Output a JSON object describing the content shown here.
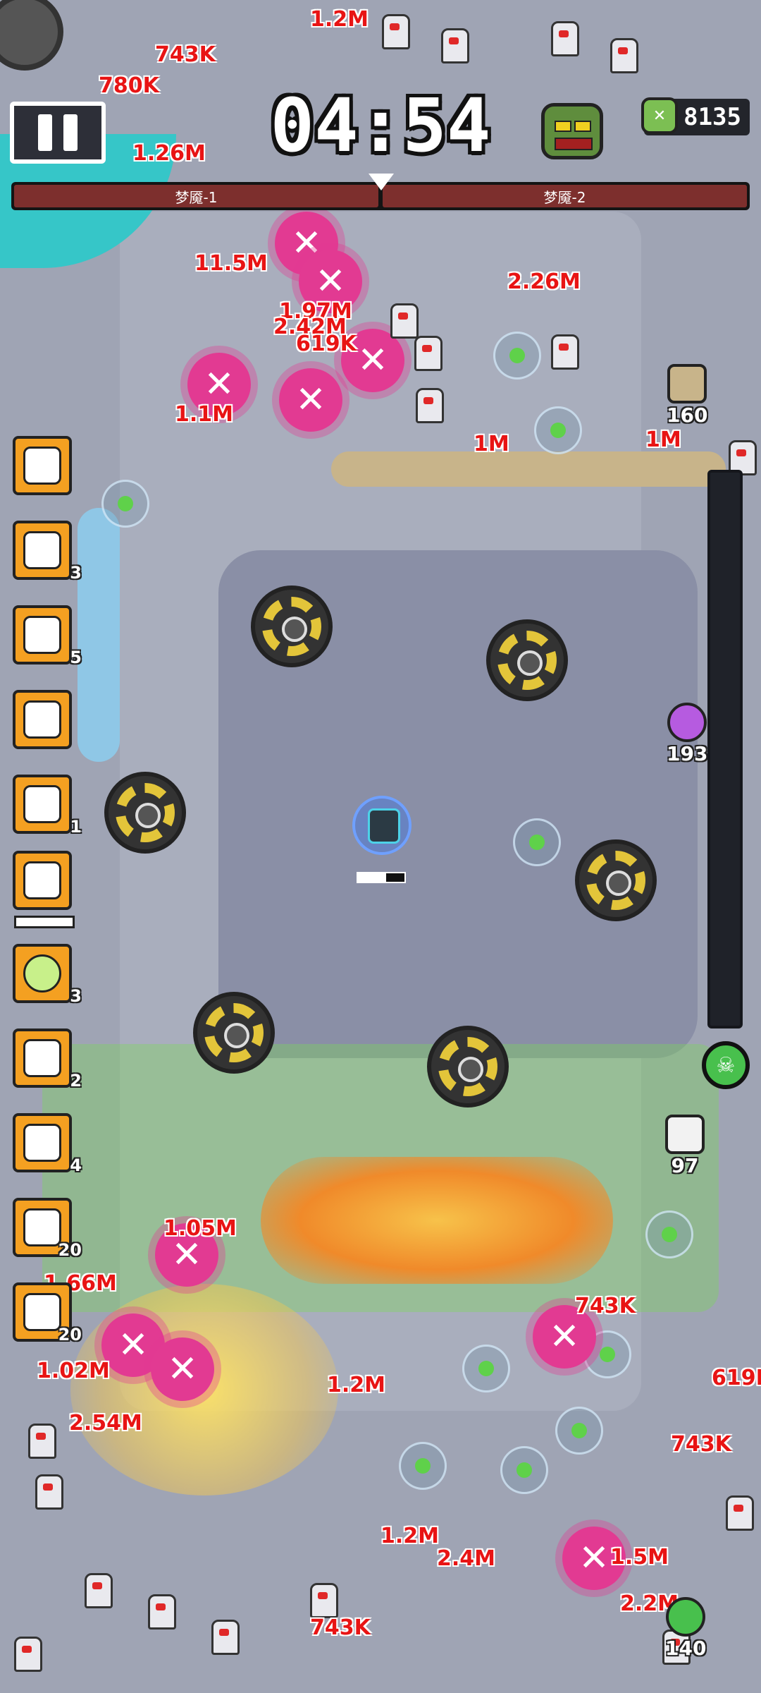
{
  "hud": {
    "timer": "04:54",
    "kill_count": "8135",
    "waves": [
      "梦魇-1",
      "梦魇-2"
    ]
  },
  "skills": [
    {
      "icon": "robot-icon",
      "level": ""
    },
    {
      "icon": "beast-icon",
      "level": "3"
    },
    {
      "icon": "card-icon",
      "level": "5"
    },
    {
      "icon": "heart-icon",
      "level": ""
    },
    {
      "icon": "chick-icon",
      "level": "1"
    },
    {
      "icon": "return-arrow-icon",
      "level": ""
    },
    {
      "icon": "coin-icon",
      "level": "3"
    },
    {
      "icon": "house-icon",
      "level": "2"
    },
    {
      "icon": "upgrade-arrow-icon",
      "level": "4"
    },
    {
      "icon": "cap-heart-icon",
      "level": "20"
    },
    {
      "icon": "cap-heart-icon",
      "level": "20"
    }
  ],
  "map_markers": {
    "marker_a": "160",
    "marker_b": "193",
    "marker_c": "97",
    "marker_d": "140"
  },
  "damage_numbers": [
    "11.5M",
    "1.97M",
    "2.42M",
    "619K",
    "2.26M",
    "1.1M",
    "1M",
    "1M",
    "1.05M",
    "1.66M",
    "1.02M",
    "743K",
    "1.2M",
    "619K",
    "743K",
    "2.54M",
    "1.2M",
    "2.4M",
    "1.5M",
    "2.2M",
    "1.26M",
    "1.2M",
    "743K",
    "780K",
    "743K"
  ],
  "colors": {
    "accent_orange": "#f4a021",
    "progress_green": "#3bd44a",
    "wave_red": "#7d2f2d",
    "damage_red": "#e81414"
  }
}
